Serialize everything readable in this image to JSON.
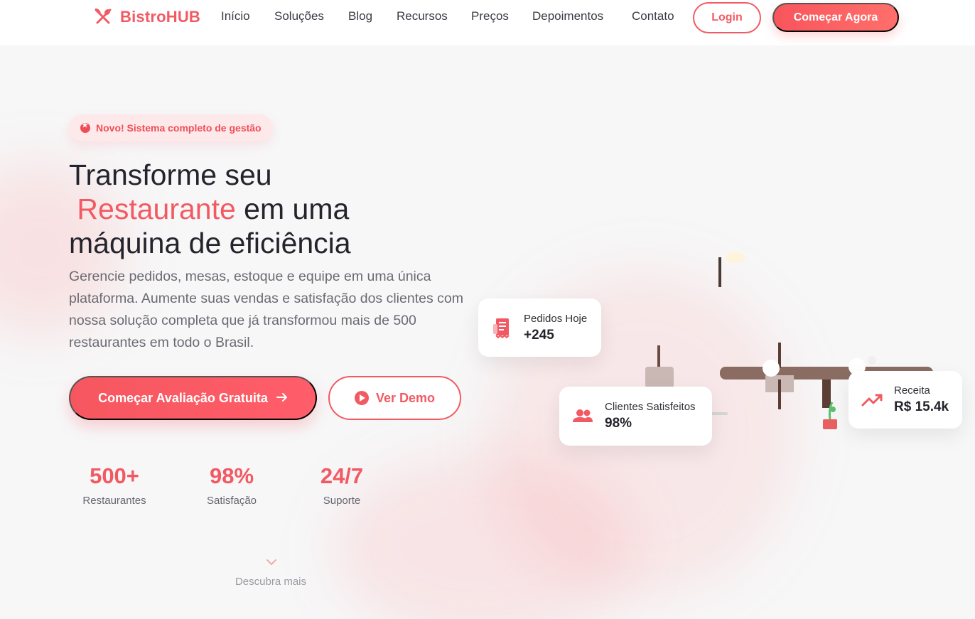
{
  "brand": {
    "name": "BistroHUB",
    "color": "#f25a63"
  },
  "nav": {
    "links": [
      "Início",
      "Soluções",
      "Blog",
      "Recursos",
      "Preços",
      "Depoimentos",
      "Contato"
    ],
    "login_label": "Login",
    "start_label": "Começar Agora"
  },
  "hero": {
    "badge": "Novo! Sistema completo de gestão",
    "title_line1": "Transforme seu",
    "title_accent": "Restaurante",
    "title_line2_rest": "em uma",
    "title_line3": "máquina de eficiência",
    "subtitle": "Gerencie pedidos, mesas, estoque e equipe em uma única plataforma. Aumente suas vendas e satisfação dos clientes com nossa solução completa que já transformou mais de 500 restaurantes em todo o Brasil.",
    "cta_primary": "Começar Avaliação Gratuita",
    "cta_secondary": "Ver Demo"
  },
  "stats": [
    {
      "value": "500+",
      "label": "Restaurantes"
    },
    {
      "value": "98%",
      "label": "Satisfação"
    },
    {
      "value": "24/7",
      "label": "Suporte"
    }
  ],
  "discover_label": "Descubra mais",
  "cards": [
    {
      "title": "Pedidos Hoje",
      "value": "+245",
      "icon": "receipt-icon"
    },
    {
      "title": "Clientes Satisfeitos",
      "value": "98%",
      "icon": "users-icon"
    },
    {
      "title": "Receita",
      "value": "R$ 15.4k",
      "icon": "trending-up-icon"
    }
  ]
}
